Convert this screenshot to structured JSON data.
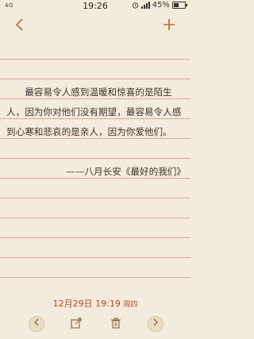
{
  "status_bar": {
    "network": "4G",
    "time": "19:26",
    "battery_percent": "45%",
    "battery_level": 0.45
  },
  "toolbar": {
    "back_icon": "chevron-left-icon",
    "add_icon": "plus-icon"
  },
  "note": {
    "body": "最容易令人感到温暖和惊喜的是陌生人，因为你对他们没有期望，最容易令人感到心寒和悲哀的是亲人，因为你爱他们。",
    "signature": "——八月长安《最好的我们》"
  },
  "footer": {
    "date": "12月29日",
    "time": "19:19",
    "weekday": "周四"
  },
  "bottom_bar": {
    "prev_icon": "chevron-left-icon",
    "share_icon": "share-icon",
    "delete_icon": "trash-icon",
    "next_icon": "chevron-right-icon"
  },
  "colors": {
    "accent": "#b8683a",
    "date_text": "#b04a2a",
    "paper": "#f3ecdc",
    "rule_line": "#d6a89a"
  }
}
